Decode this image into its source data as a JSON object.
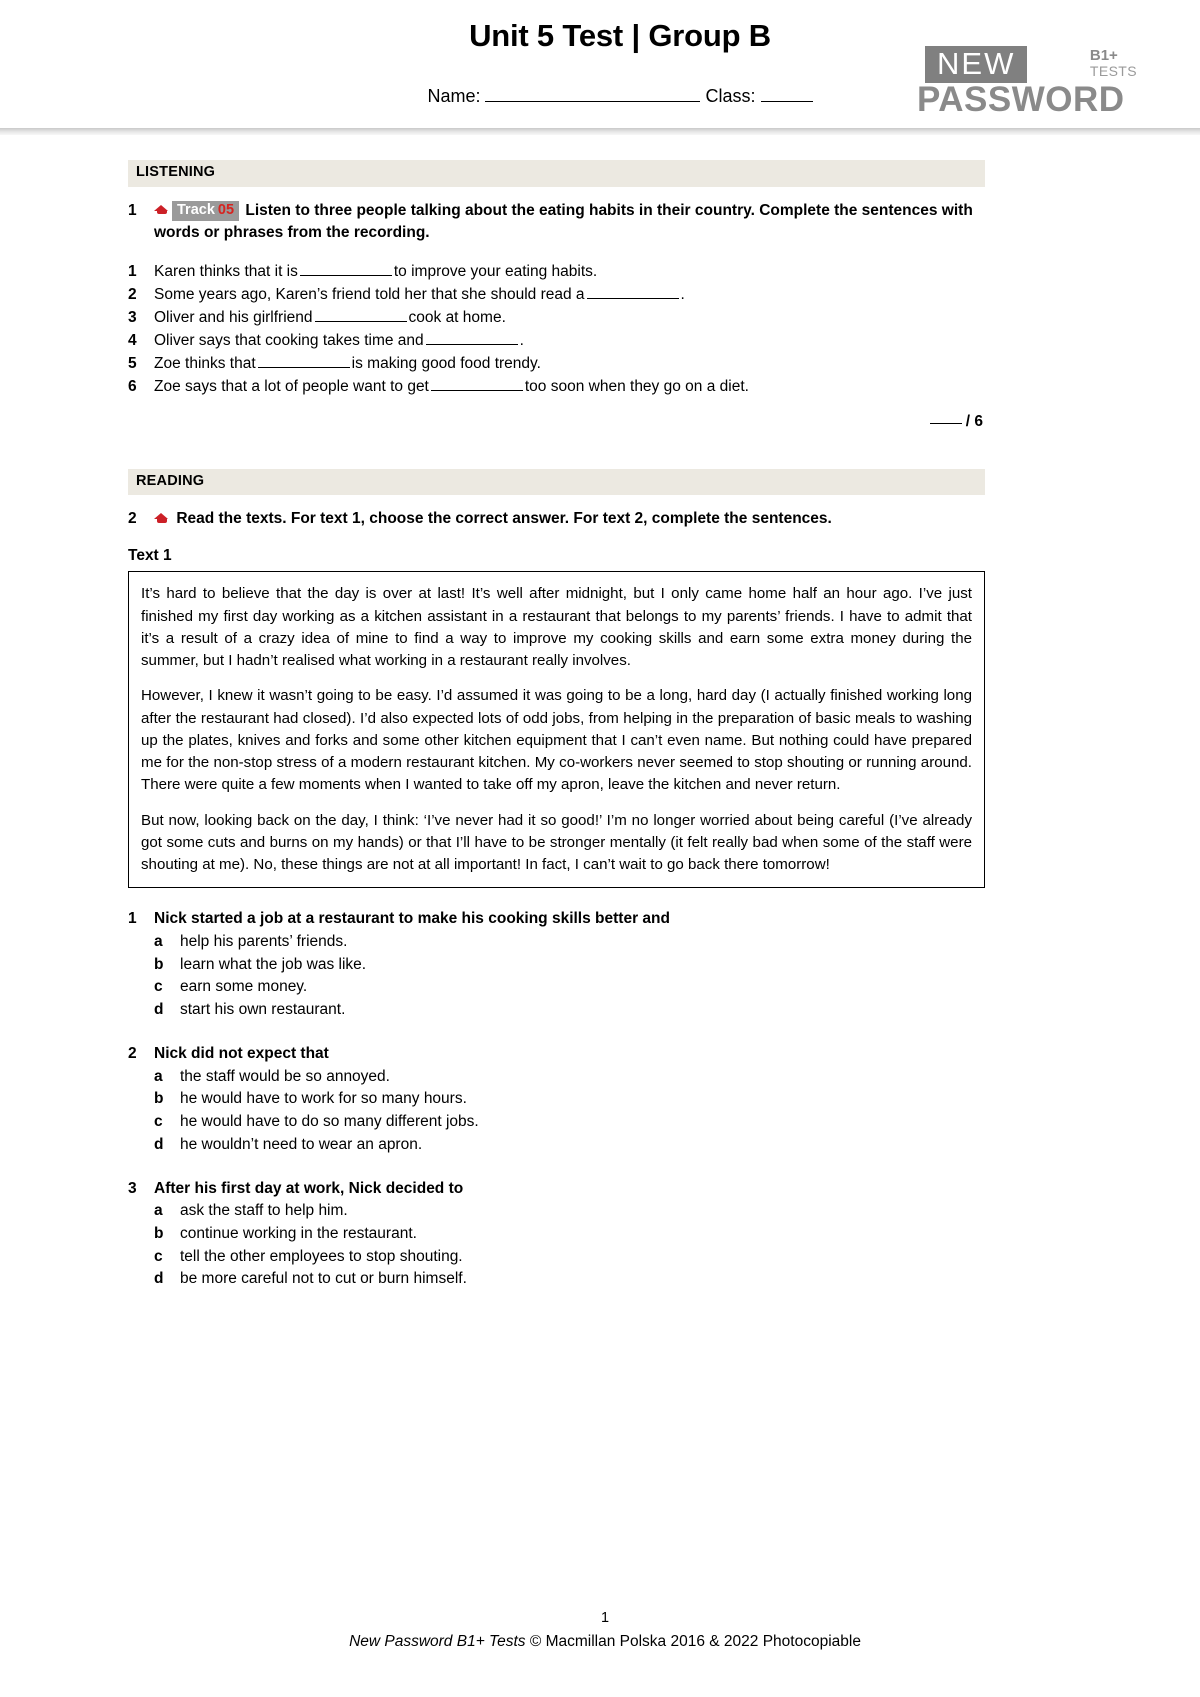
{
  "header": {
    "title": "Unit 5 Test | Group B",
    "name_label": "Name:",
    "class_label": "Class:",
    "logo": {
      "new": "NEW",
      "password": "PASSWORD",
      "level": "B1+",
      "tests": "TESTS"
    }
  },
  "colors": {
    "section_bar_bg": "#ece9e1",
    "track_badge_bg": "#9a9a9a",
    "track_number": "#d7231f",
    "cap_icon": "#cc2027",
    "logo_gray": "#808080",
    "logo_text_gray": "#8a8a8a"
  },
  "listening": {
    "section_label": "LISTENING",
    "task_number": "1",
    "track_label": "Track",
    "track_number": "05",
    "instruction": "Listen to three people talking about the eating habits in their country. Complete the sentences with words or phrases from the recording.",
    "items": [
      {
        "n": "1",
        "before": "Karen thinks that it is",
        "after": "to improve your eating habits."
      },
      {
        "n": "2",
        "before": "Some years ago, Karen’s friend told her that she should read a",
        "after": "."
      },
      {
        "n": "3",
        "before": "Oliver and his girlfriend",
        "after": "cook at home."
      },
      {
        "n": "4",
        "before": "Oliver says that cooking takes time and",
        "after": "."
      },
      {
        "n": "5",
        "before": "Zoe thinks that",
        "after": "is making good food trendy."
      },
      {
        "n": "6",
        "before": "Zoe says that a lot of people want to get",
        "after": "too soon when they go on a diet."
      }
    ],
    "score": "/ 6"
  },
  "reading": {
    "section_label": "READING",
    "task_number": "2",
    "instruction": "Read the texts. For text 1, choose the correct answer. For text 2, complete the sentences.",
    "text1_label": "Text 1",
    "text1_paragraphs": [
      "It’s hard to believe that the day is over at last! It’s well after midnight, but I only came home half an hour ago. I’ve just finished my first day working as a kitchen assistant in a restaurant that belongs to my parents’ friends. I have to admit that it’s a result of a crazy idea of mine to find a way to improve my cooking skills and earn some extra money during the summer, but I hadn’t realised what working in a restaurant really involves.",
      "However, I knew it wasn’t going to be easy. I’d assumed it was going to be a long, hard day (I actually finished working long after the restaurant had closed). I’d also expected lots of odd jobs, from helping in the preparation of basic meals to washing up the plates, knives and forks and some other kitchen equipment that I can’t even name. But nothing could have prepared me for the non-stop stress of a modern restaurant kitchen. My co-workers never seemed to stop shouting or running around. There were quite a few moments when I wanted to take off my apron, leave the kitchen and never return.",
      "But now, looking back on the day, I think: ‘I’ve never had it so good!’ I’m no longer worried about being careful (I’ve already got some cuts and burns on my hands) or that I’ll have to be stronger mentally (it felt really bad when some of the staff were shouting at me). No, these things are not at all important! In fact, I can’t wait to go back there tomorrow!"
    ],
    "questions": [
      {
        "n": "1",
        "stem": "Nick started a job at a restaurant to make his cooking skills better and",
        "options": [
          {
            "letter": "a",
            "text": "help his parents’ friends."
          },
          {
            "letter": "b",
            "text": "learn what the job was like."
          },
          {
            "letter": "c",
            "text": "earn some money."
          },
          {
            "letter": "d",
            "text": "start his own restaurant."
          }
        ]
      },
      {
        "n": "2",
        "stem": "Nick did not expect that",
        "options": [
          {
            "letter": "a",
            "text": "the staff would be so annoyed."
          },
          {
            "letter": "b",
            "text": "he would have to work for so many hours."
          },
          {
            "letter": "c",
            "text": "he would have to do so many different jobs."
          },
          {
            "letter": "d",
            "text": "he wouldn’t need to wear an apron."
          }
        ]
      },
      {
        "n": "3",
        "stem": "After his first day at work, Nick decided to",
        "options": [
          {
            "letter": "a",
            "text": "ask the staff to help him."
          },
          {
            "letter": "b",
            "text": "continue working in the restaurant."
          },
          {
            "letter": "c",
            "text": "tell the other employees to stop shouting."
          },
          {
            "letter": "d",
            "text": "be more careful not to cut or burn himself."
          }
        ]
      }
    ]
  },
  "footer": {
    "page_number": "1",
    "credit_italic": "New Password B1+ Tests ",
    "credit_rest": "© Macmillan Polska 2016 & 2022 Photocopiable"
  }
}
